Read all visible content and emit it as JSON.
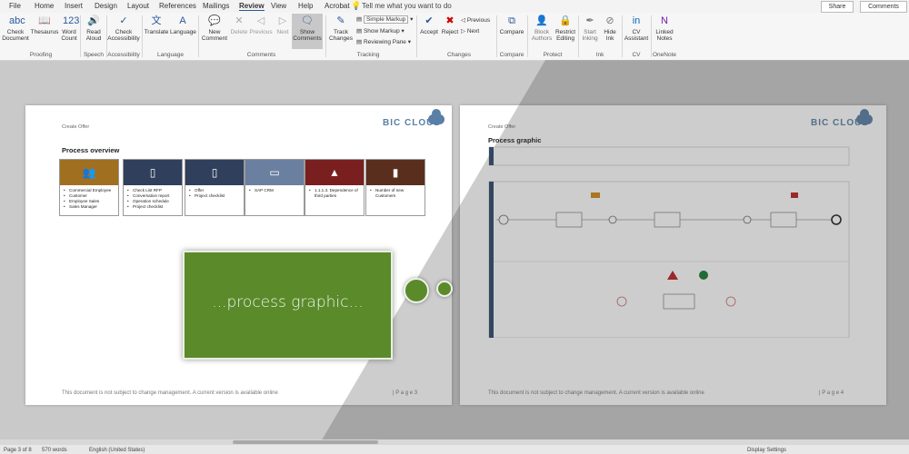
{
  "tabs": [
    "File",
    "Home",
    "Insert",
    "Design",
    "Layout",
    "References",
    "Mailings",
    "Review",
    "View",
    "Help",
    "Acrobat"
  ],
  "active_tab": "Review",
  "tell_me": "Tell me what you want to do",
  "share_label": "Share",
  "comments_label": "Comments",
  "ribbon": {
    "check_doc": "Check Document",
    "thesaurus": "Thesaurus",
    "word_count": "Word Count",
    "read_aloud": "Read Aloud",
    "check_access": "Check Accessibility",
    "translate": "Translate",
    "language": "Language",
    "new_comment": "New Comment",
    "delete": "Delete",
    "previous": "Previous",
    "next": "Next",
    "show_comments": "Show Comments",
    "track_changes": "Track Changes",
    "simple_markup": "Simple Markup",
    "show_markup": "Show Markup",
    "reviewing_pane": "Reviewing Pane",
    "accept": "Accept",
    "reject": "Reject",
    "prev_change": "Previous",
    "next_change": "Next",
    "compare": "Compare",
    "block_authors": "Block Authors",
    "restrict_editing": "Restrict Editing",
    "start_inking": "Start Inking",
    "hide_ink": "Hide Ink",
    "cv_assistant": "CV Assistant",
    "linked_notes": "Linked Notes",
    "groups": {
      "proofing": "Proofing",
      "speech": "Speech",
      "accessibility": "Accessibility",
      "language": "Language",
      "comments": "Comments",
      "tracking": "Tracking",
      "changes": "Changes",
      "compare": "Compare",
      "protect": "Protect",
      "ink": "Ink",
      "cv": "CV",
      "onenote": "OneNote"
    }
  },
  "page3": {
    "header": "Create Offer",
    "logo": "BIC CLOUD",
    "section_title": "Process overview",
    "cards": [
      {
        "color": "#a07020",
        "icon": "people-icon",
        "glyph": "👥",
        "items": [
          "Commercial Employee",
          "Customer",
          "Employee Sales",
          "Sales Manager"
        ]
      },
      {
        "color": "#2f3f5c",
        "icon": "document-icon",
        "glyph": "▯",
        "items": [
          "Check List RFP",
          "Conversation report",
          "Operation schedule",
          "Project checklist"
        ]
      },
      {
        "color": "#2f3f5c",
        "icon": "document-out-icon",
        "glyph": "▯",
        "items": [
          "Offer",
          "Project checklist"
        ]
      },
      {
        "color": "#6b7fa0",
        "icon": "monitor-icon",
        "glyph": "▭",
        "items": [
          "SAP CRM"
        ]
      },
      {
        "color": "#7a1f1f",
        "icon": "warning-icon",
        "glyph": "▲",
        "items": [
          "1.1.1.3. Dependence of third parties"
        ]
      },
      {
        "color": "#5a2e1c",
        "icon": "bar-chart-icon",
        "glyph": "▮",
        "items": [
          "Number of new Customers"
        ]
      }
    ],
    "footer": "This document is not subject to change management. A current version is available online",
    "page_label": "| P a g e  3"
  },
  "page4": {
    "header": "Create Offer",
    "logo": "BIC CLOUD",
    "section_title": "Process graphic",
    "footer": "This document is not subject to change management. A current version is available online",
    "page_label": "| P a g e  4"
  },
  "overlay_text": "...process graphic...",
  "status": {
    "page": "Page 3 of 8",
    "words": "570 words",
    "language": "English (United States)",
    "display": "Display Settings"
  }
}
